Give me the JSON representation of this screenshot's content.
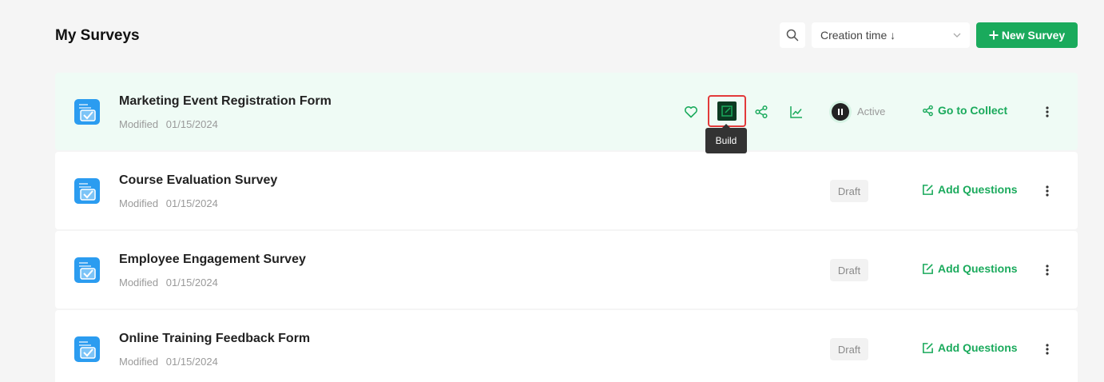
{
  "page": {
    "title": "My Surveys"
  },
  "toolbar": {
    "sort_value": "Creation time ↓",
    "new_label": "New Survey"
  },
  "colors": {
    "accent": "#1aaa5c",
    "highlight": "#e23a3a",
    "active_row": "#effbf5"
  },
  "tooltip": {
    "build": "Build"
  },
  "surveys": [
    {
      "title": "Marketing Event Registration Form",
      "modified_label": "Modified",
      "modified_date": "01/15/2024",
      "status": "Active",
      "action": "Go to Collect"
    },
    {
      "title": "Course Evaluation Survey",
      "modified_label": "Modified",
      "modified_date": "01/15/2024",
      "status": "Draft",
      "action": "Add Questions"
    },
    {
      "title": "Employee Engagement Survey",
      "modified_label": "Modified",
      "modified_date": "01/15/2024",
      "status": "Draft",
      "action": "Add Questions"
    },
    {
      "title": "Online Training Feedback Form",
      "modified_label": "Modified",
      "modified_date": "01/15/2024",
      "status": "Draft",
      "action": "Add Questions"
    }
  ]
}
